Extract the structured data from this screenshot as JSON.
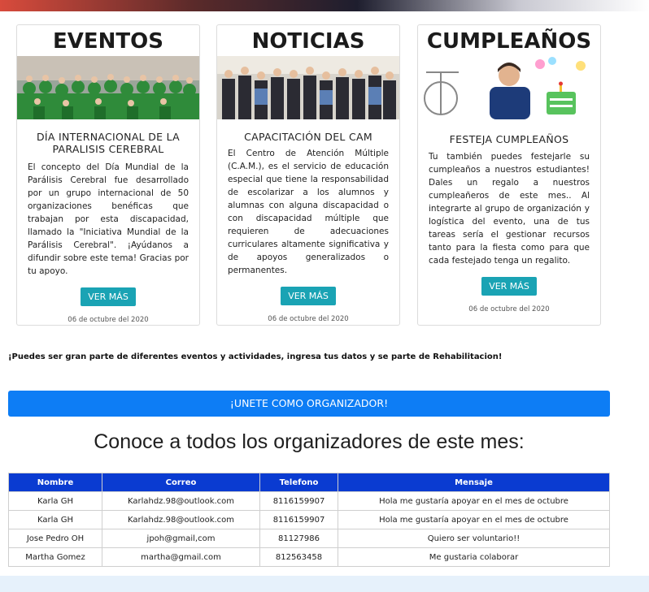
{
  "cards": [
    {
      "title": "EVENTOS",
      "subtitle": "DÍA INTERNACIONAL DE LA PARALISIS CEREBRAL",
      "text": "El concepto del Día Mundial de la Parálisis Cerebral fue desarrollado por un grupo internacional de 50 organizaciones benéficas que trabajan por esta discapacidad, llamado la \"Iniciativa Mundial de la Parálisis Cerebral\". ¡Ayúdanos a difundir sobre este tema! Gracias por tu apoyo.",
      "button": "VER MÁS",
      "date": "06 de octubre del 2020"
    },
    {
      "title": "NOTICIAS",
      "subtitle": "CAPACITACIÓN DEL CAM",
      "text": "El Centro de Atención Múltiple (C.A.M.), es el servicio de educación especial que tiene la responsabilidad de escolarizar a los alumnos y alumnas con alguna discapacidad o con discapacidad múltiple que requieren de adecuaciones curriculares altamente significativa y de apoyos generalizados o permanentes.",
      "button": "VER MÁS",
      "date": "06 de octubre del 2020"
    },
    {
      "title": "CUMPLEAÑOS",
      "subtitle": "FESTEJA CUMPLEAÑOS",
      "text": "Tu también puedes festejarle su cumpleaños a nuestros estudiantes! Dales un regalo a nuestros cumpleañeros de este mes.. Al integrarte al grupo de organización y logística del evento, una de tus tareas sería el gestionar recursos tanto para la fiesta como para que cada festejado tenga un regalito.",
      "button": "VER MÁS",
      "date": "06 de octubre del 2020"
    }
  ],
  "promo_text": "¡Puedes ser gran parte de diferentes eventos y actividades, ingresa tus datos y se parte de Rehabilitacion!",
  "join_button": "¡UNETE COMO ORGANIZADOR!",
  "organizers_heading": "Conoce a todos los organizadores de este mes:",
  "table": {
    "headers": [
      "Nombre",
      "Correo",
      "Telefono",
      "Mensaje"
    ],
    "rows": [
      [
        "Karla GH",
        "Karlahdz.98@outlook.com",
        "8116159907",
        "Hola me gustaría apoyar en el mes de octubre"
      ],
      [
        "Karla GH",
        "Karlahdz.98@outlook.com",
        "8116159907",
        "Hola me gustaría apoyar en el mes de octubre"
      ],
      [
        "Jose Pedro OH",
        "jpoh@gmail,com",
        "81127986",
        "Quiero ser voluntario!!"
      ],
      [
        "Martha Gomez",
        "martha@gmail.com",
        "812563458",
        "Me gustaria colaborar"
      ]
    ]
  },
  "colors": {
    "join_button": "#0d7df5",
    "table_header": "#0a3bd1",
    "card_button": "#1aa3b4"
  }
}
